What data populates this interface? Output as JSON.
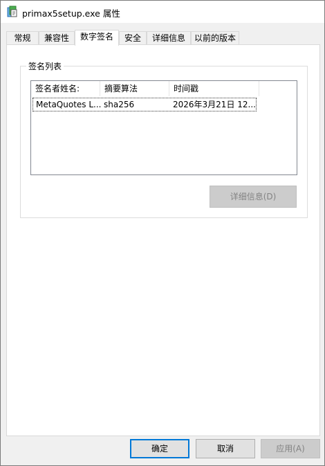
{
  "window": {
    "title": "primax5setup.exe 属性",
    "icon": "installer-app-icon"
  },
  "tabs": [
    {
      "label": "常规"
    },
    {
      "label": "兼容性"
    },
    {
      "label": "数字签名",
      "active": true
    },
    {
      "label": "安全"
    },
    {
      "label": "详细信息"
    },
    {
      "label": "以前的版本"
    }
  ],
  "signatures": {
    "group_label": "签名列表",
    "columns": [
      "签名者姓名:",
      "摘要算法",
      "时间戳"
    ],
    "rows": [
      {
        "signer": "MetaQuotes L...",
        "digest": "sha256",
        "timestamp": "2026年3月21日 12..."
      }
    ],
    "details_button": "详细信息(D)"
  },
  "footer": {
    "ok": "确定",
    "cancel": "取消",
    "apply": "应用(A)"
  },
  "colors": {
    "primary_border": "#0078d7",
    "disabled_text": "#838383"
  }
}
